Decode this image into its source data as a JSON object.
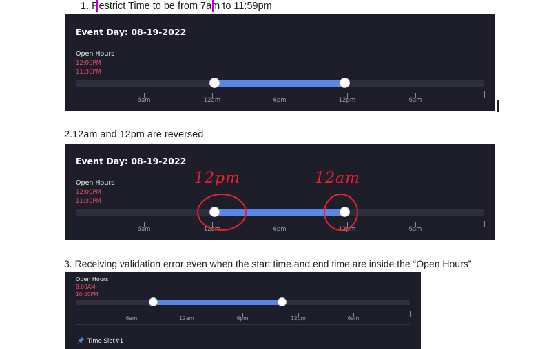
{
  "notes": {
    "note1": "1.  Restrict Time to be from 7am to 11:59pm",
    "note2": "2.12am and 12pm are reversed",
    "note3": "3. Receiving validation error even when the start time and end time are inside the “Open Hours”"
  },
  "panel1": {
    "title": "Event Day: 08-19-2022",
    "open_hours_label": "Open Hours",
    "open_time": "12:00PM",
    "close_time": "11:30PM",
    "range_fraction": [
      0.333,
      0.666
    ],
    "ticks": [
      "6am",
      "12am",
      "6pm",
      "12pm",
      "6am"
    ]
  },
  "panel2": {
    "title": "Event Day: 08-19-2022",
    "open_hours_label": "Open Hours",
    "open_time": "12:00PM",
    "close_time": "11:30PM",
    "range_fraction": [
      0.333,
      0.666
    ],
    "ticks": [
      "6am",
      "12am",
      "6pm",
      "12pm",
      "6am"
    ],
    "annotations": {
      "left": "12pm",
      "right": "12am"
    }
  },
  "panel3": {
    "open_hours_label": "Open Hours",
    "open_time": "8:00AM",
    "close_time": "10:00PM",
    "range_fraction": [
      0.25,
      0.625
    ],
    "ticks": [
      "6am",
      "12am",
      "6pm",
      "12pm",
      "6am"
    ],
    "slot_label": "Time Slot#1",
    "slot_icon": "pin-icon"
  },
  "colors": {
    "panel_bg": "#1e1e2a",
    "track": "#2e2e3e",
    "fill": "#5b86e8",
    "time_red": "#e6506a",
    "annotation_red": "#e8212f"
  }
}
